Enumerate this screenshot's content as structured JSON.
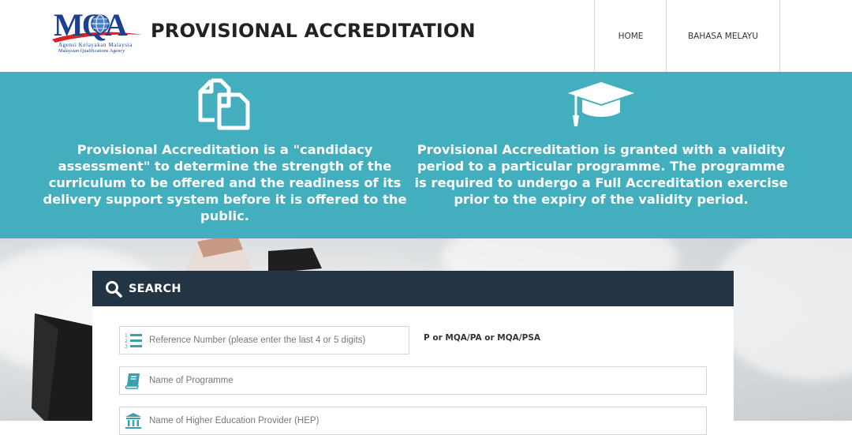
{
  "header": {
    "logo_text": "MQA",
    "logo_tagline_ms": "Agensi Kelayakan Malaysia",
    "logo_tagline_en": "Malaysian Qualifications Agency",
    "title": "PROVISIONAL ACCREDITATION",
    "nav": [
      {
        "label": "HOME"
      },
      {
        "label": "BAHASA MELAYU"
      }
    ]
  },
  "features": [
    {
      "icon": "documents-icon",
      "text": "Provisional Accreditation is a \"candidacy assessment\" to determine the strength of the curriculum to be offered and the readiness of its delivery support system before it is offered to the public."
    },
    {
      "icon": "graduation-cap-icon",
      "text": "Provisional Accreditation is granted with a validity period to a particular programme. The programme is required to undergo a Full Accreditation exercise prior to the expiry of the validity period."
    }
  ],
  "colors": {
    "band": "#43aebd",
    "search_header": "#233544",
    "icon_teal": "#3a9fae"
  },
  "search": {
    "title": "SEARCH",
    "reference_placeholder": "Reference Number (please enter the last 4 or 5 digits)",
    "reference_hint": "P or MQA/PA or MQA/PSA",
    "programme_placeholder": "Name of Programme",
    "hep_placeholder": "Name of Higher Education Provider (HEP)"
  }
}
